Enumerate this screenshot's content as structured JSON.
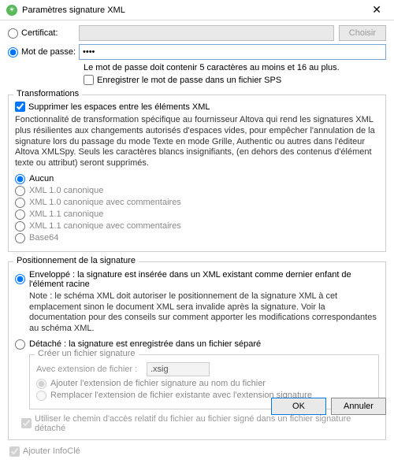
{
  "titlebar": {
    "title": "Paramètres signature XML"
  },
  "auth": {
    "cert_label": "Certificat:",
    "pass_label": "Mot de passe:",
    "password_value": "••••",
    "choose_btn": "Choisir",
    "pass_note": "Le mot de passe doit contenir 5 caractères au moins et 16 au plus.",
    "save_sps_label": "Enregistrer le mot de passe dans un fichier SPS"
  },
  "transforms": {
    "legend": "Transformations",
    "strip_ws_label": "Supprimer les espaces entre les éléments XML",
    "description": "Fonctionnalité de transformation spécifique au fournisseur Altova qui rend les signatures XML plus résilientes aux changements autorisés d'espaces vides, pour empêcher l'annulation de la signature lors du passage du mode Texte en mode Grille, Authentic ou autres dans l'éditeur Altova XMLSpy. Seuls les caractères blancs insignifiants, (en dehors des contenus d'élément texte ou attribut) seront supprimés.",
    "opts": {
      "none": "Aucun",
      "c14n10": "XML 1.0 canonique",
      "c14n10c": "XML 1.0 canonique avec commentaires",
      "c14n11": "XML 1.1 canonique",
      "c14n11c": "XML 1.1 canonique avec commentaires",
      "base64": "Base64"
    }
  },
  "placement": {
    "legend": "Positionnement de la signature",
    "enveloped_label": "Enveloppé : la signature est insérée dans un XML existant comme dernier enfant de l'élément racine",
    "enveloped_note": "Note : le schéma XML doit autoriser le positionnement de la signature XML à cet emplacement sinon le document XML sera invalide après la signature. Voir la documentation pour des conseils sur comment apporter les modifications correspondantes au schéma XML.",
    "detached_label": "Détaché : la signature est enregistrée dans un fichier séparé",
    "sigfile": {
      "legend": "Créer un fichier signature",
      "ext_label": "Avec extension de fichier :",
      "ext_value": ".xsig",
      "append_label": "Ajouter l'extension de fichier signature au nom du fichier",
      "replace_label": "Remplacer l'extension de fichier existante avec l'extension signature"
    },
    "relpath_label": "Utiliser le chemin d'accès relatif du fichier au fichier signé dans un fichier signature détaché"
  },
  "keyinfo_label": "Ajouter InfoClé",
  "footer": {
    "ok": "OK",
    "cancel": "Annuler"
  }
}
